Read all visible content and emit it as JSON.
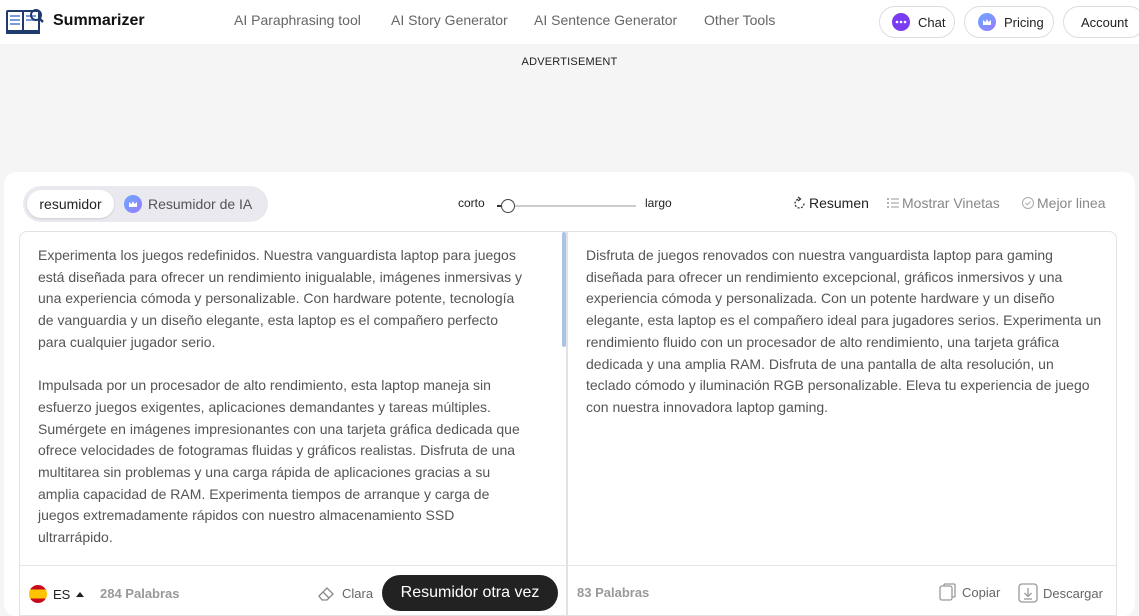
{
  "header": {
    "brand": "Summarizer",
    "nav": [
      "AI Paraphrasing tool",
      "AI Story Generator",
      "AI Sentence Generator",
      "Other Tools"
    ],
    "chat_label": "Chat",
    "pricing_label": "Pricing",
    "account_label": "Account"
  },
  "ad_label": "ADVERTISEMENT",
  "toolbar": {
    "mode_active": "resumidor",
    "mode_ai": "Resumidor de IA",
    "length_short": "corto",
    "length_long": "largo",
    "length_value": 0.05,
    "opt_summary": "Resumen",
    "opt_bullets": "Mostrar Vinetas",
    "opt_best": "Mejor linea"
  },
  "input": {
    "paragraph1": "Experimenta los juegos redefinidos. Nuestra vanguardista laptop para juegos está diseñada para ofrecer un rendimiento inigualable, imágenes inmersivas y una experiencia cómoda y personalizable. Con hardware potente, tecnología de vanguardia y un diseño elegante, esta laptop es el compañero perfecto para cualquier jugador serio.",
    "paragraph2": "Impulsada por un procesador de alto rendimiento, esta laptop maneja sin esfuerzo juegos exigentes, aplicaciones demandantes y tareas múltiples. Sumérgete en imágenes impresionantes con una tarjeta gráfica dedicada que ofrece velocidades de fotogramas fluidas y gráficos realistas. Disfruta de una multitarea sin problemas y una carga rápida de aplicaciones gracias a su amplia capacidad de RAM. Experimenta tiempos de arranque y carga de juegos extremadamente rápidos con nuestro almacenamiento SSD ultrarrápido.",
    "lang": "ES",
    "word_count": "284 Palabras",
    "clear_label": "Clara",
    "submit_label": "Resumidor otra vez"
  },
  "output": {
    "text": "Disfruta de juegos renovados con nuestra vanguardista laptop para gaming diseñada para ofrecer un rendimiento excepcional, gráficos inmersivos y una experiencia cómoda y personalizada. Con un potente hardware y un diseño elegante, esta laptop es el compañero ideal para jugadores serios. Experimenta un rendimiento fluido con un procesador de alto rendimiento, una tarjeta gráfica dedicada y una amplia RAM. Disfruta de una pantalla de alta resolución, un teclado cómodo y iluminación RGB personalizable. Eleva tu experiencia de juego con nuestra innovadora laptop gaming.",
    "word_count": "83 Palabras",
    "copy_label": "Copiar",
    "download_label": "Descargar"
  }
}
